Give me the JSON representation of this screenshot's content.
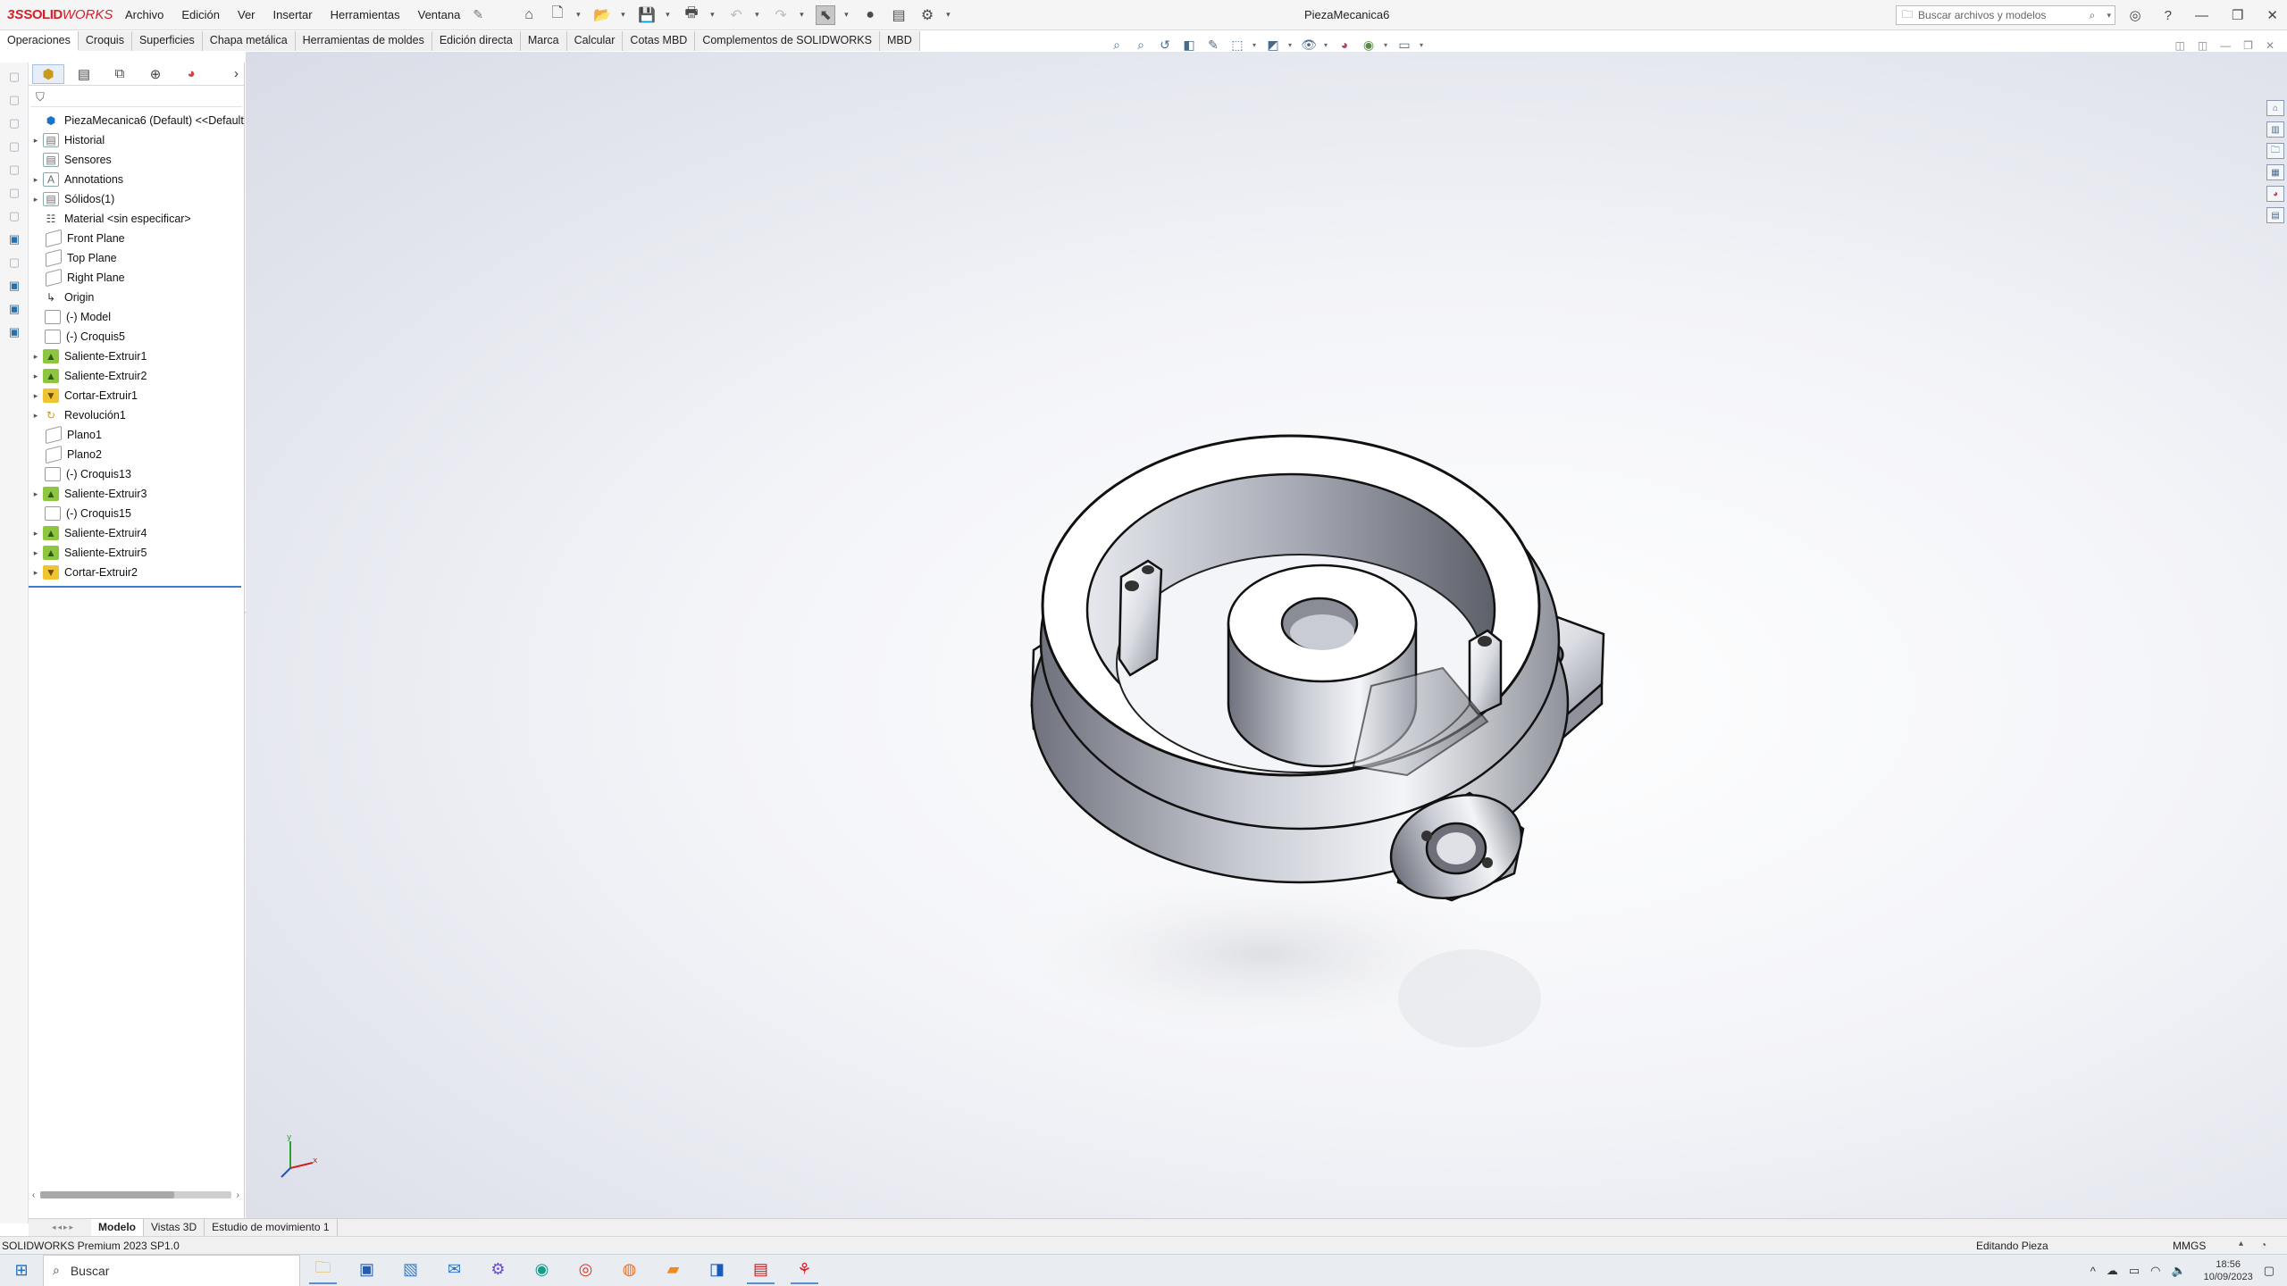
{
  "app": {
    "logo_ds": "3S",
    "logo_solid": "SOLID",
    "logo_works": "WORKS",
    "document_title": "PiezaMecanica6"
  },
  "menu": [
    "Archivo",
    "Edición",
    "Ver",
    "Insertar",
    "Herramientas",
    "Ventana"
  ],
  "search": {
    "placeholder": "Buscar archivos y modelos"
  },
  "command_tabs": [
    "Operaciones",
    "Croquis",
    "Superficies",
    "Chapa metálica",
    "Herramientas de moldes",
    "Edición directa",
    "Marca",
    "Calcular",
    "Cotas MBD",
    "Complementos de SOLIDWORKS",
    "MBD"
  ],
  "feature_tree": [
    {
      "label": "PiezaMecanica6 (Default) <<Default",
      "icon": "part-icon",
      "expand": false
    },
    {
      "label": "Historial",
      "icon": "folder-icon",
      "expand": true
    },
    {
      "label": "Sensores",
      "icon": "folder-icon",
      "expand": false
    },
    {
      "label": "Annotations",
      "icon": "annotation-icon",
      "expand": true
    },
    {
      "label": "Sólidos(1)",
      "icon": "folder-icon",
      "expand": true
    },
    {
      "label": "Material <sin especificar>",
      "icon": "material-icon",
      "expand": false
    },
    {
      "label": "Front Plane",
      "icon": "plane-icon",
      "expand": false
    },
    {
      "label": "Top Plane",
      "icon": "plane-icon",
      "expand": false
    },
    {
      "label": "Right Plane",
      "icon": "plane-icon",
      "expand": false
    },
    {
      "label": "Origin",
      "icon": "origin-icon",
      "expand": false
    },
    {
      "label": "(-) Model",
      "icon": "sketch-icon",
      "expand": false
    },
    {
      "label": "(-) Croquis5",
      "icon": "sketch-icon",
      "expand": false
    },
    {
      "label": "Saliente-Extruir1",
      "icon": "boss-extrude-icon",
      "expand": true
    },
    {
      "label": "Saliente-Extruir2",
      "icon": "boss-extrude-icon",
      "expand": true
    },
    {
      "label": "Cortar-Extruir1",
      "icon": "cut-extrude-icon",
      "expand": true
    },
    {
      "label": "Revolución1",
      "icon": "revolve-icon",
      "expand": true
    },
    {
      "label": "Plano1",
      "icon": "plane-icon",
      "expand": false
    },
    {
      "label": "Plano2",
      "icon": "plane-icon",
      "expand": false
    },
    {
      "label": "(-) Croquis13",
      "icon": "sketch-icon",
      "expand": false
    },
    {
      "label": "Saliente-Extruir3",
      "icon": "boss-extrude-icon",
      "expand": true
    },
    {
      "label": "(-) Croquis15",
      "icon": "sketch-icon",
      "expand": false
    },
    {
      "label": "Saliente-Extruir4",
      "icon": "boss-extrude-icon",
      "expand": true
    },
    {
      "label": "Saliente-Extruir5",
      "icon": "boss-extrude-icon",
      "expand": true
    },
    {
      "label": "Cortar-Extruir2",
      "icon": "cut-extrude-icon",
      "expand": true
    }
  ],
  "bottom_tabs": [
    "Modelo",
    "Vistas 3D",
    "Estudio de movimiento 1"
  ],
  "status": {
    "left": "SOLIDWORKS Premium 2023 SP1.0",
    "mode": "Editando Pieza",
    "units": "MMGS"
  },
  "taskbar": {
    "search_placeholder": "Buscar",
    "time": "18:56",
    "date": "10/09/2023",
    "apps": [
      "file-explorer-icon",
      "store-icon",
      "photos-icon",
      "mail-icon",
      "settings-icon",
      "edge-icon",
      "chrome-icon",
      "firefox-icon",
      "sublime-icon",
      "outlook-icon",
      "solidworks-2023-icon",
      "solidworks-icon"
    ]
  },
  "triad": {
    "x_label": "x",
    "y_label": "y"
  },
  "colors": {
    "brand_red": "#d4202a",
    "selection_blue": "#3d7bcb",
    "boss_green": "#8ec63f",
    "cut_yellow": "#f0c330"
  }
}
